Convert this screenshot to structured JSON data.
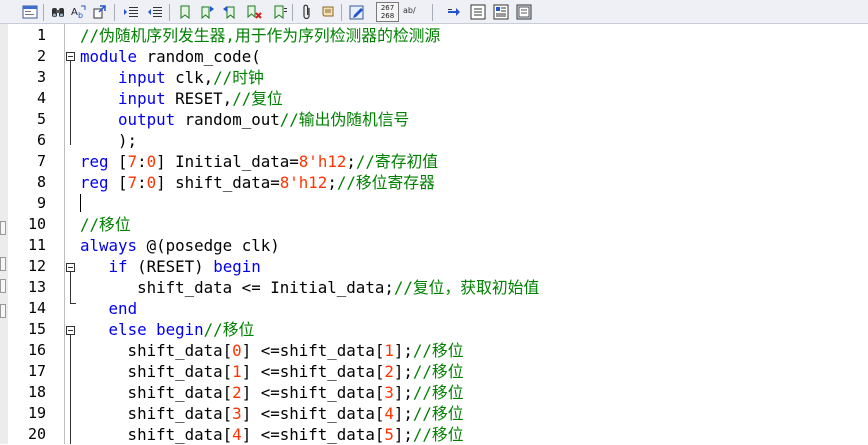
{
  "toolbar": {
    "icons": [
      "window-icon",
      "binoculars-icon",
      "replace-icon",
      "goto-icon",
      "indent-icon",
      "outdent-icon",
      "bookmark-toggle-icon",
      "bookmark-next-icon",
      "bookmark-prev-icon",
      "bookmark-clear-icon",
      "paperclip-icon",
      "scroll-icon",
      "edit-icon",
      "line-numbers-icon",
      "word-wrap-icon",
      "arrow-right-icon",
      "list-icon",
      "doc-icon",
      "panel-icon"
    ],
    "number_badge": "267\n268",
    "ab_label": "ab/"
  },
  "editor": {
    "line_numbers": [
      "1",
      "2",
      "3",
      "4",
      "5",
      "6",
      "7",
      "8",
      "9",
      "10",
      "11",
      "12",
      "13",
      "14",
      "15",
      "16",
      "17",
      "18",
      "19",
      "20"
    ],
    "lines": [
      [
        [
          "cm",
          "//伪随机序列发生器,用于作为序列检测器的检测源"
        ]
      ],
      [
        [
          "kw",
          "module"
        ],
        [
          "pl",
          " random_code("
        ]
      ],
      [
        [
          "pl",
          "    "
        ],
        [
          "kw",
          "input"
        ],
        [
          "pl",
          " clk,"
        ],
        [
          "cm",
          "//时钟"
        ]
      ],
      [
        [
          "pl",
          "    "
        ],
        [
          "kw",
          "input"
        ],
        [
          "pl",
          " RESET,"
        ],
        [
          "cm",
          "//复位"
        ]
      ],
      [
        [
          "pl",
          "    "
        ],
        [
          "kw",
          "output"
        ],
        [
          "pl",
          " random_out"
        ],
        [
          "cm",
          "//输出伪随机信号"
        ]
      ],
      [
        [
          "pl",
          "    );"
        ]
      ],
      [
        [
          "kw",
          "reg"
        ],
        [
          "pl",
          " ["
        ],
        [
          "num",
          "7"
        ],
        [
          "pl",
          ":"
        ],
        [
          "num",
          "0"
        ],
        [
          "pl",
          "] Initial_data="
        ],
        [
          "num",
          "8'h12"
        ],
        [
          "pl",
          ";"
        ],
        [
          "cm",
          "//寄存初值"
        ]
      ],
      [
        [
          "kw",
          "reg"
        ],
        [
          "pl",
          " ["
        ],
        [
          "num",
          "7"
        ],
        [
          "pl",
          ":"
        ],
        [
          "num",
          "0"
        ],
        [
          "pl",
          "] shift_data="
        ],
        [
          "num",
          "8'h12"
        ],
        [
          "pl",
          ";"
        ],
        [
          "cm",
          "//移位寄存器"
        ]
      ],
      [],
      [
        [
          "cm",
          "//移位"
        ]
      ],
      [
        [
          "kw",
          "always"
        ],
        [
          "pl",
          " @(posedge clk)"
        ]
      ],
      [
        [
          "pl",
          "   "
        ],
        [
          "kw",
          "if"
        ],
        [
          "pl",
          " (RESET) "
        ],
        [
          "kw",
          "begin"
        ]
      ],
      [
        [
          "pl",
          "      shift_data <= Initial_data;"
        ],
        [
          "cm",
          "//复位，获取初始值"
        ]
      ],
      [
        [
          "pl",
          "   "
        ],
        [
          "kw",
          "end"
        ]
      ],
      [
        [
          "pl",
          "   "
        ],
        [
          "kw",
          "else"
        ],
        [
          "pl",
          " "
        ],
        [
          "kw",
          "begin"
        ],
        [
          "cm",
          "//移位"
        ]
      ],
      [
        [
          "pl",
          "     shift_data["
        ],
        [
          "num",
          "0"
        ],
        [
          "pl",
          "] <=shift_data["
        ],
        [
          "num",
          "1"
        ],
        [
          "pl",
          "];"
        ],
        [
          "cm",
          "//移位"
        ]
      ],
      [
        [
          "pl",
          "     shift_data["
        ],
        [
          "num",
          "1"
        ],
        [
          "pl",
          "] <=shift_data["
        ],
        [
          "num",
          "2"
        ],
        [
          "pl",
          "];"
        ],
        [
          "cm",
          "//移位"
        ]
      ],
      [
        [
          "pl",
          "     shift_data["
        ],
        [
          "num",
          "2"
        ],
        [
          "pl",
          "] <=shift_data["
        ],
        [
          "num",
          "3"
        ],
        [
          "pl",
          "];"
        ],
        [
          "cm",
          "//移位"
        ]
      ],
      [
        [
          "pl",
          "     shift_data["
        ],
        [
          "num",
          "3"
        ],
        [
          "pl",
          "] <=shift_data["
        ],
        [
          "num",
          "4"
        ],
        [
          "pl",
          "];"
        ],
        [
          "cm",
          "//移位"
        ]
      ],
      [
        [
          "pl",
          "     shift_data["
        ],
        [
          "num",
          "4"
        ],
        [
          "pl",
          "] <=shift_data["
        ],
        [
          "num",
          "5"
        ],
        [
          "pl",
          "];"
        ],
        [
          "cm",
          "//移位"
        ]
      ]
    ]
  }
}
